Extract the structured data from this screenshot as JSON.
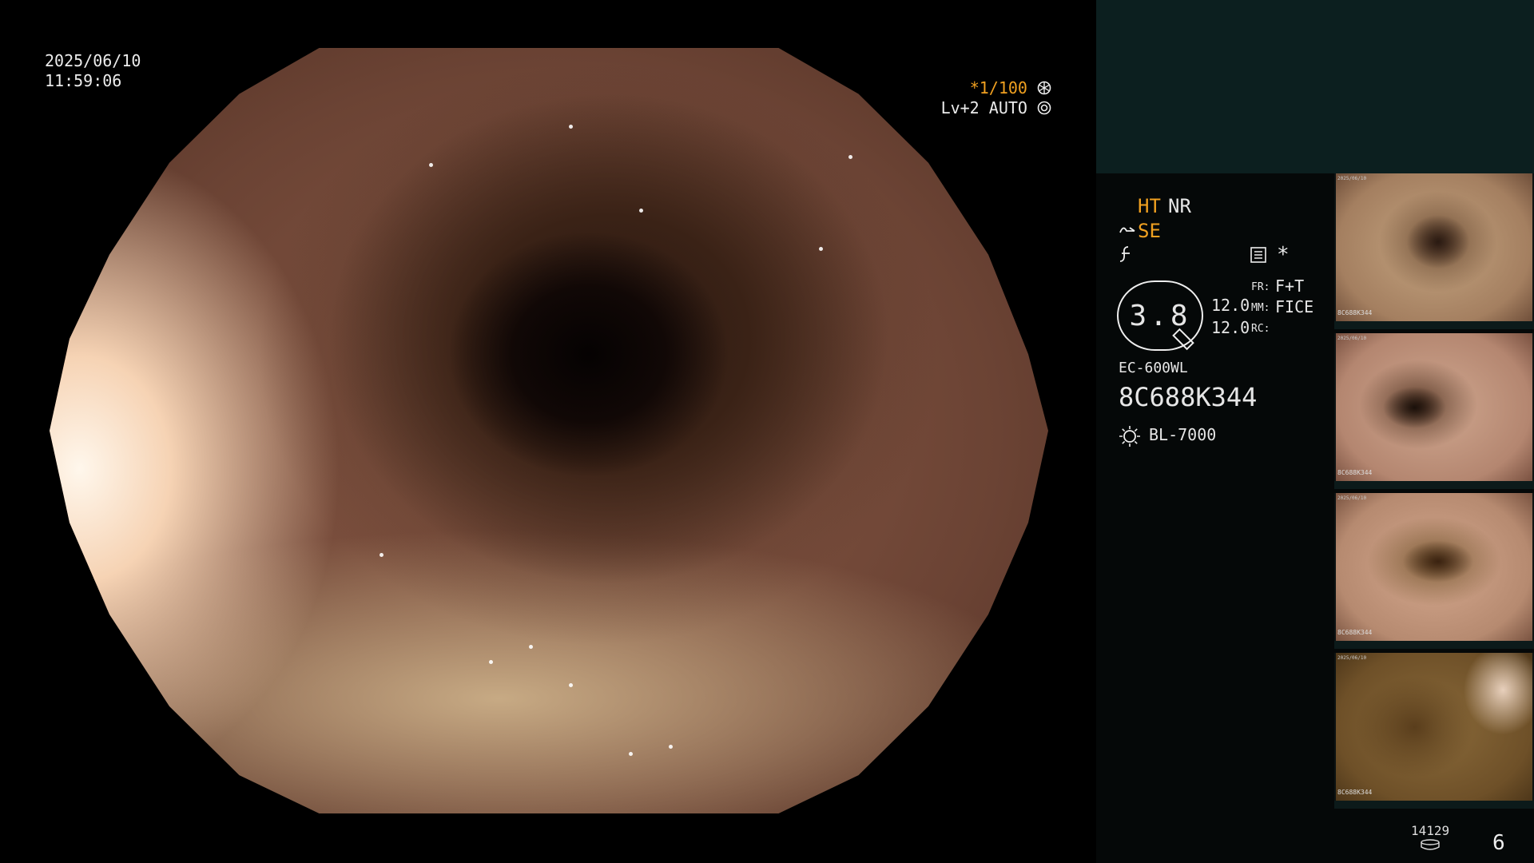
{
  "osd": {
    "date": "2025/06/10",
    "time": "11:59:06",
    "shutter": "*1/100",
    "level": "Lv+2",
    "mode": "AUTO"
  },
  "side": {
    "ht": "HT",
    "nr": "NR",
    "se": "SE",
    "asterisk": "*",
    "zoom": "3.8",
    "val1": "12.0",
    "val2": "12.0",
    "fr_label": "FR:",
    "fr_value": "F+T",
    "mm_label": "MM:",
    "mm_value": "FICE",
    "rc_label": "RC:",
    "scope_model": "EC-600WL",
    "scope_serial": "8C688K344",
    "light_source": "BL-7000"
  },
  "thumbnails": [
    {
      "caption": "8C688K344"
    },
    {
      "caption": "8C688K344"
    },
    {
      "caption": "8C688K344"
    },
    {
      "caption": "8C688K344"
    }
  ],
  "footer": {
    "storage_count": "14129",
    "image_count": "6"
  },
  "colors": {
    "amber": "#f0a020",
    "panel_top": "#0c1f1f",
    "panel": "#050808"
  },
  "icons": [
    "aperture-icon",
    "auto-iris-icon",
    "se-mode-icon",
    "function-icon",
    "menu-card-icon",
    "zoom-handle-icon",
    "light-source-icon",
    "storage-icon"
  ]
}
